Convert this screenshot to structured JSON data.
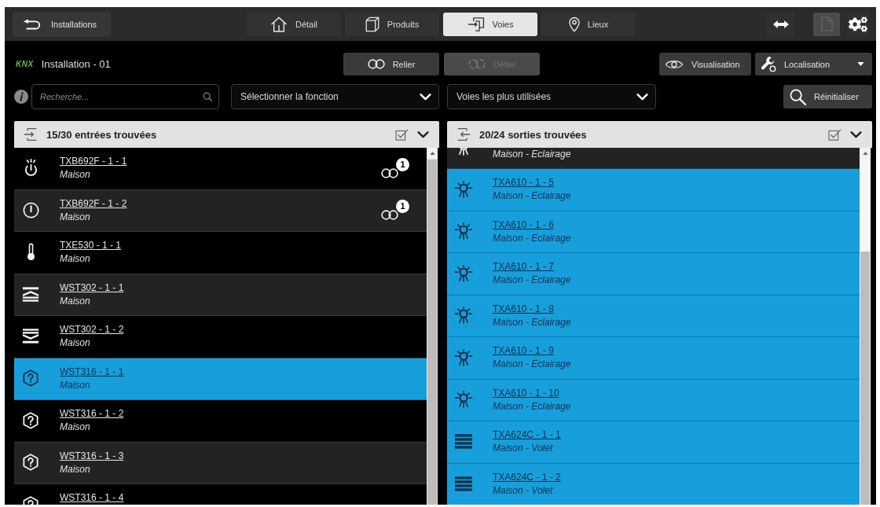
{
  "nav": {
    "back_button": {
      "label": "Installations"
    },
    "tabs": [
      {
        "label": "Détail",
        "selected": false
      },
      {
        "label": "Produits",
        "selected": false
      },
      {
        "label": "Voies",
        "selected": true
      },
      {
        "label": "Lieux",
        "selected": false
      }
    ],
    "tools": [
      {
        "kind": "transfer",
        "disabled": false
      },
      {
        "kind": "document",
        "disabled": true
      },
      {
        "kind": "settings",
        "disabled": false
      }
    ]
  },
  "header": {
    "logo": "KNX",
    "title": "Installation - 01",
    "link_buttons": [
      {
        "label": "Relier",
        "disabled": false
      },
      {
        "label": "Délier",
        "disabled": true
      }
    ],
    "view_button": {
      "label": "Visualisation"
    },
    "location_button": {
      "label": "Localisation"
    }
  },
  "filters": {
    "search": {
      "placeholder": "Recherche..."
    },
    "function_select": {
      "value": "Sélectionner la fonction"
    },
    "channel_select": {
      "value": "Voies les plus utilisées"
    },
    "reset_button": {
      "label": "Réinitialiser"
    }
  },
  "panels": [
    {
      "title": "15/30 entrées trouvées",
      "rows": [
        {
          "name": "TXB692F - 1 - 1",
          "location": "Maison",
          "kind": "touch",
          "selected": false,
          "links": "1"
        },
        {
          "name": "TXB692F - 1 - 2",
          "location": "Maison",
          "kind": "switch",
          "selected": false,
          "links": "1"
        },
        {
          "name": "TXE530 - 1 - 1",
          "location": "Maison",
          "kind": "temperature",
          "selected": false
        },
        {
          "name": "WST302 - 1 - 1",
          "location": "Maison",
          "kind": "bars-up",
          "selected": false
        },
        {
          "name": "WST302 - 1 - 2",
          "location": "Maison",
          "kind": "bars-down",
          "selected": false
        },
        {
          "name": "WST316 - 1 - 1",
          "location": "Maison",
          "kind": "unknown",
          "selected": true
        },
        {
          "name": "WST316 - 1 - 2",
          "location": "Maison",
          "kind": "unknown",
          "selected": false
        },
        {
          "name": "WST316 - 1 - 3",
          "location": "Maison",
          "kind": "unknown",
          "selected": false
        },
        {
          "name": "WST316 - 1 - 4",
          "kind": "unknown",
          "selected": false
        }
      ]
    },
    {
      "title": "20/24 sorties trouvées",
      "rows": [
        {
          "location": "Maison - Eclairage",
          "kind": "light",
          "selected": false
        },
        {
          "name": "TXA610 - 1 - 5",
          "location": "Maison - Eclairage",
          "kind": "light",
          "selected": true
        },
        {
          "name": "TXA610 - 1 - 6",
          "location": "Maison - Eclairage",
          "kind": "light",
          "selected": true
        },
        {
          "name": "TXA610 - 1 - 7",
          "location": "Maison - Eclairage",
          "kind": "light",
          "selected": true
        },
        {
          "name": "TXA610 - 1 - 8",
          "location": "Maison - Eclairage",
          "kind": "light",
          "selected": true
        },
        {
          "name": "TXA610 - 1 - 9",
          "location": "Maison - Eclairage",
          "kind": "light",
          "selected": true
        },
        {
          "name": "TXA610 - 1 - 10",
          "location": "Maison - Eclairage",
          "kind": "light",
          "selected": true
        },
        {
          "name": "TXA624C - 1 - 1",
          "location": "Maison - Volet",
          "kind": "shutter",
          "selected": true
        },
        {
          "name": "TXA624C - 1 - 2",
          "location": "Maison - Volet",
          "kind": "shutter",
          "selected": true
        }
      ]
    }
  ]
}
